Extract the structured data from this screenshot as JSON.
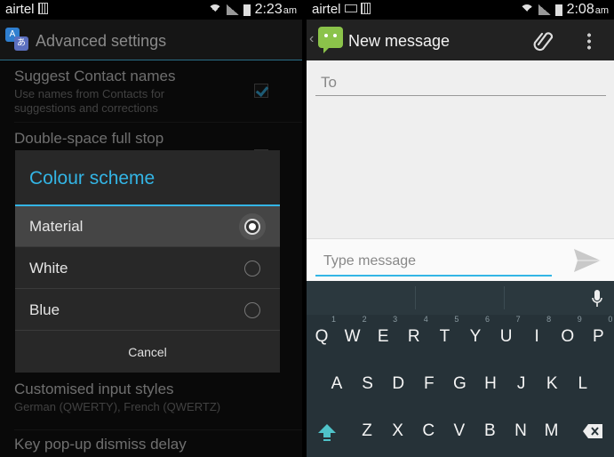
{
  "left": {
    "status": {
      "carrier": "airtel",
      "time": "2:23",
      "ampm": "am"
    },
    "header": {
      "title": "Advanced settings"
    },
    "prefs": [
      {
        "title": "Suggest Contact names",
        "summary": "Use names from Contacts for suggestions and corrections",
        "checked": true
      },
      {
        "title": "Double-space full stop",
        "summary": "",
        "checked": true
      },
      {
        "title": "Customised input styles",
        "summary": "German (QWERTY), French (QWERTZ)"
      },
      {
        "title": "Key pop-up dismiss delay",
        "summary": ""
      }
    ],
    "dialog": {
      "title": "Colour scheme",
      "options": [
        {
          "label": "Material",
          "selected": true
        },
        {
          "label": "White",
          "selected": false
        },
        {
          "label": "Blue",
          "selected": false
        }
      ],
      "cancel_label": "Cancel"
    }
  },
  "right": {
    "status": {
      "carrier": "airtel",
      "time": "2:08",
      "ampm": "am"
    },
    "header": {
      "title": "New message"
    },
    "to_placeholder": "To",
    "compose_placeholder": "Type message",
    "keyboard": {
      "row1": [
        "Q",
        "W",
        "E",
        "R",
        "T",
        "Y",
        "U",
        "I",
        "O",
        "P"
      ],
      "row1_hints": [
        "1",
        "2",
        "3",
        "4",
        "5",
        "6",
        "7",
        "8",
        "9",
        "0"
      ],
      "row2": [
        "A",
        "S",
        "D",
        "F",
        "G",
        "H",
        "J",
        "K",
        "L"
      ],
      "row3": [
        "Z",
        "X",
        "C",
        "V",
        "B",
        "N",
        "M"
      ]
    }
  },
  "colors": {
    "accent": "#33b5e5",
    "app_green": "#8bc34a",
    "keyboard_bg": "#263238"
  }
}
